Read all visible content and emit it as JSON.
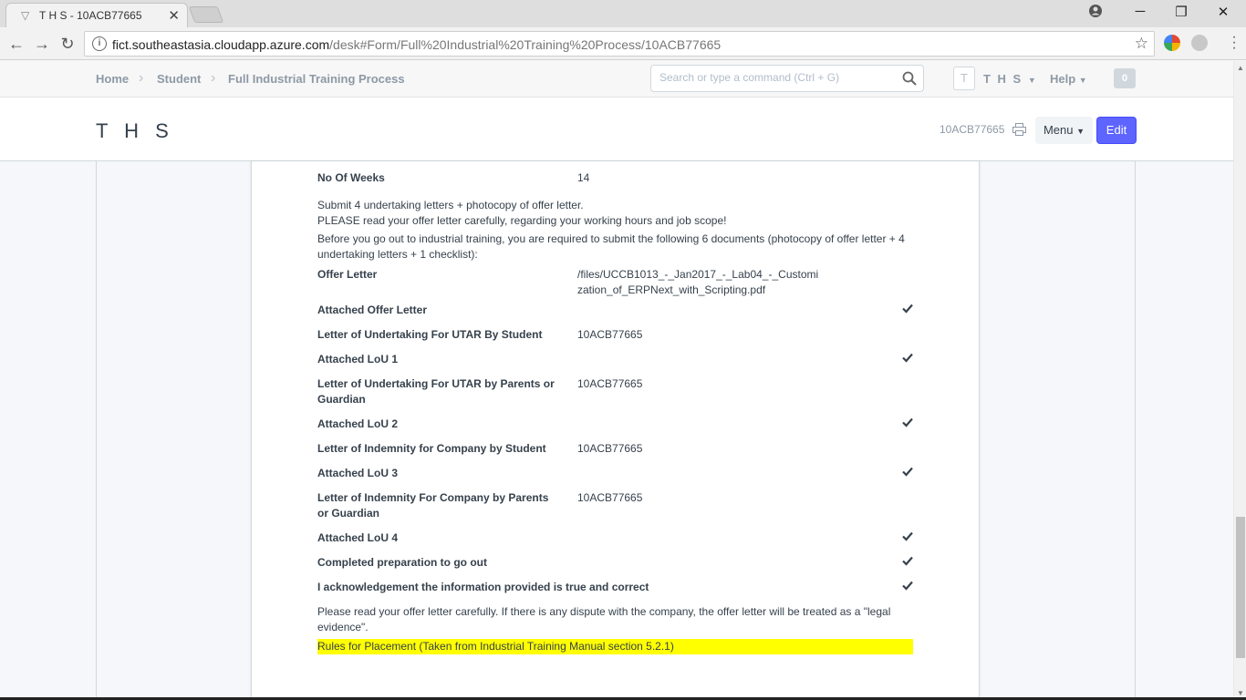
{
  "browser": {
    "tab_title": "T H S - 10ACB77665",
    "url_host": "fict.southeastasia.cloudapp.azure.com",
    "url_path": "/desk#Form/Full%20Industrial%20Training%20Process/10ACB77665",
    "icons": [
      "back-icon",
      "forward-icon",
      "reload-icon",
      "info-icon",
      "star-icon",
      "account-icon",
      "minimize-icon",
      "restore-icon",
      "close-icon"
    ]
  },
  "navbar": {
    "breadcrumbs": [
      "Home",
      "Student",
      "Full Industrial Training Process"
    ],
    "search_placeholder": "Search or type a command (Ctrl + G)",
    "avatar_letter": "T",
    "user_label": "T H S",
    "help_label": "Help",
    "notification_count": "0"
  },
  "page": {
    "title": "T H S",
    "doc_id": "10ACB77665",
    "menu_label": "Menu",
    "edit_label": "Edit"
  },
  "form": {
    "no_of_weeks_label": "No Of Weeks",
    "no_of_weeks_value": "14",
    "note1": "Submit 4 undertaking letters + photocopy of offer letter.",
    "note2": "PLEASE read your offer letter carefully, regarding your working hours and job scope!",
    "note3": "Before you go out to industrial training, you are required to submit the following 6 documents (photocopy of offer letter + 4 undertaking letters + 1 checklist):",
    "offer_letter_label": "Offer Letter",
    "offer_letter_value": "/files/UCCB1013_-_Jan2017_-_Lab04_-_Customization_of_ERPNext_with_Scripting.pdf",
    "attached_offer_label": "Attached Offer Letter",
    "lou_student_label": "Letter of Undertaking For UTAR By Student",
    "lou_student_value": "10ACB77665",
    "attached_lou1_label": "Attached LoU 1",
    "lou_parents_label": "Letter of Undertaking For UTAR by Parents or Guardian",
    "lou_parents_value": "10ACB77665",
    "attached_lou2_label": "Attached LoU 2",
    "loi_student_label": "Letter of Indemnity for Company by Student",
    "loi_student_value": "10ACB77665",
    "attached_lou3_label": "Attached LoU 3",
    "loi_parents_label": "Letter of Indemnity For Company by Parents or Guardian",
    "loi_parents_value": "10ACB77665",
    "attached_lou4_label": "Attached LoU 4",
    "completed_label": "Completed preparation to go out",
    "acknowledge_label": "I acknowledgement the information provided is true and correct",
    "dispute_note": "Please read your offer letter carefully. If there is any dispute with the company, the offer letter will be treated as a \"legal evidence\".",
    "rules_highlight": "Rules for Placement (Taken from Industrial Training Manual section 5.2.1)"
  },
  "colors": {
    "primary": "#5e64ff",
    "highlight": "#ffff00",
    "text": "#36414c",
    "muted": "#8d99a6"
  }
}
